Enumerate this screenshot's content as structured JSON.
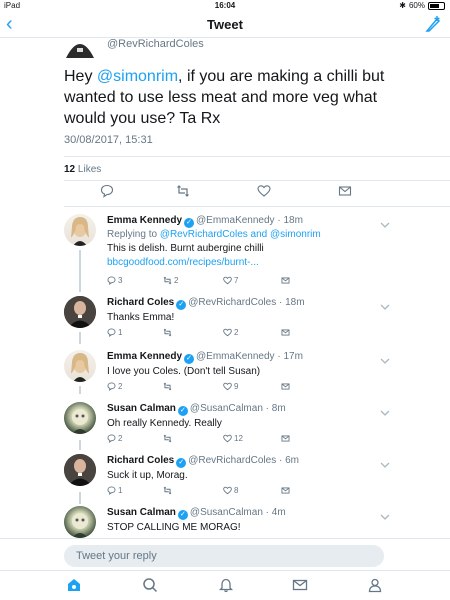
{
  "status": {
    "device": "iPad",
    "time": "16:04",
    "battery": "60%"
  },
  "nav": {
    "title": "Tweet"
  },
  "main_tweet": {
    "handle": "@RevRichardColes",
    "text_before": "Hey ",
    "mention": "@simonrim",
    "text_after": ", if you are making a chilli but wanted to use less meat and more veg what would you use? Ta Rx",
    "date": "30/08/2017, 15:31",
    "likes_count": "12",
    "likes_label": "Likes"
  },
  "replies": [
    {
      "name": "Emma Kennedy",
      "handle": "@EmmaKennedy",
      "time": "· 18m",
      "replying_prefix": "Replying to ",
      "replying_to": "@RevRichardColes and @simonrim",
      "text": "This is delish. Burnt aubergine chilli ",
      "link": "bbcgoodfood.com/recipes/burnt-...",
      "replies": "3",
      "retweets": "2",
      "likes": "7"
    },
    {
      "name": "Richard Coles",
      "handle": "@RevRichardColes",
      "time": "· 18m",
      "text": "Thanks Emma!",
      "replies": "1",
      "retweets": "",
      "likes": "2"
    },
    {
      "name": "Emma Kennedy",
      "handle": "@EmmaKennedy",
      "time": "· 17m",
      "text": "I love you Coles. (Don't tell Susan)",
      "replies": "2",
      "retweets": "",
      "likes": "9"
    },
    {
      "name": "Susan Calman",
      "handle": "@SusanCalman",
      "time": "· 8m",
      "text": "Oh really Kennedy.  Really",
      "replies": "2",
      "retweets": "",
      "likes": "12"
    },
    {
      "name": "Richard Coles",
      "handle": "@RevRichardColes",
      "time": "· 6m",
      "text": "Suck it up, Morag.",
      "replies": "1",
      "retweets": "",
      "likes": "8"
    },
    {
      "name": "Susan Calman",
      "handle": "@SusanCalman",
      "time": "· 4m",
      "text": "STOP CALLING ME MORAG!",
      "replies": "",
      "retweets": "",
      "likes": ""
    }
  ],
  "reply_bar": {
    "placeholder": "Tweet your reply"
  },
  "colors": {
    "accent": "#1da1f2",
    "muted": "#657786",
    "border": "#e1e8ed"
  },
  "icons": [
    "back-chevron-icon",
    "compose-feather-icon",
    "reply-icon",
    "retweet-icon",
    "like-heart-icon",
    "direct-message-icon",
    "chevron-down-icon",
    "home-icon",
    "search-icon",
    "notifications-bell-icon",
    "messages-envelope-icon",
    "profile-person-icon",
    "verified-badge-icon"
  ]
}
